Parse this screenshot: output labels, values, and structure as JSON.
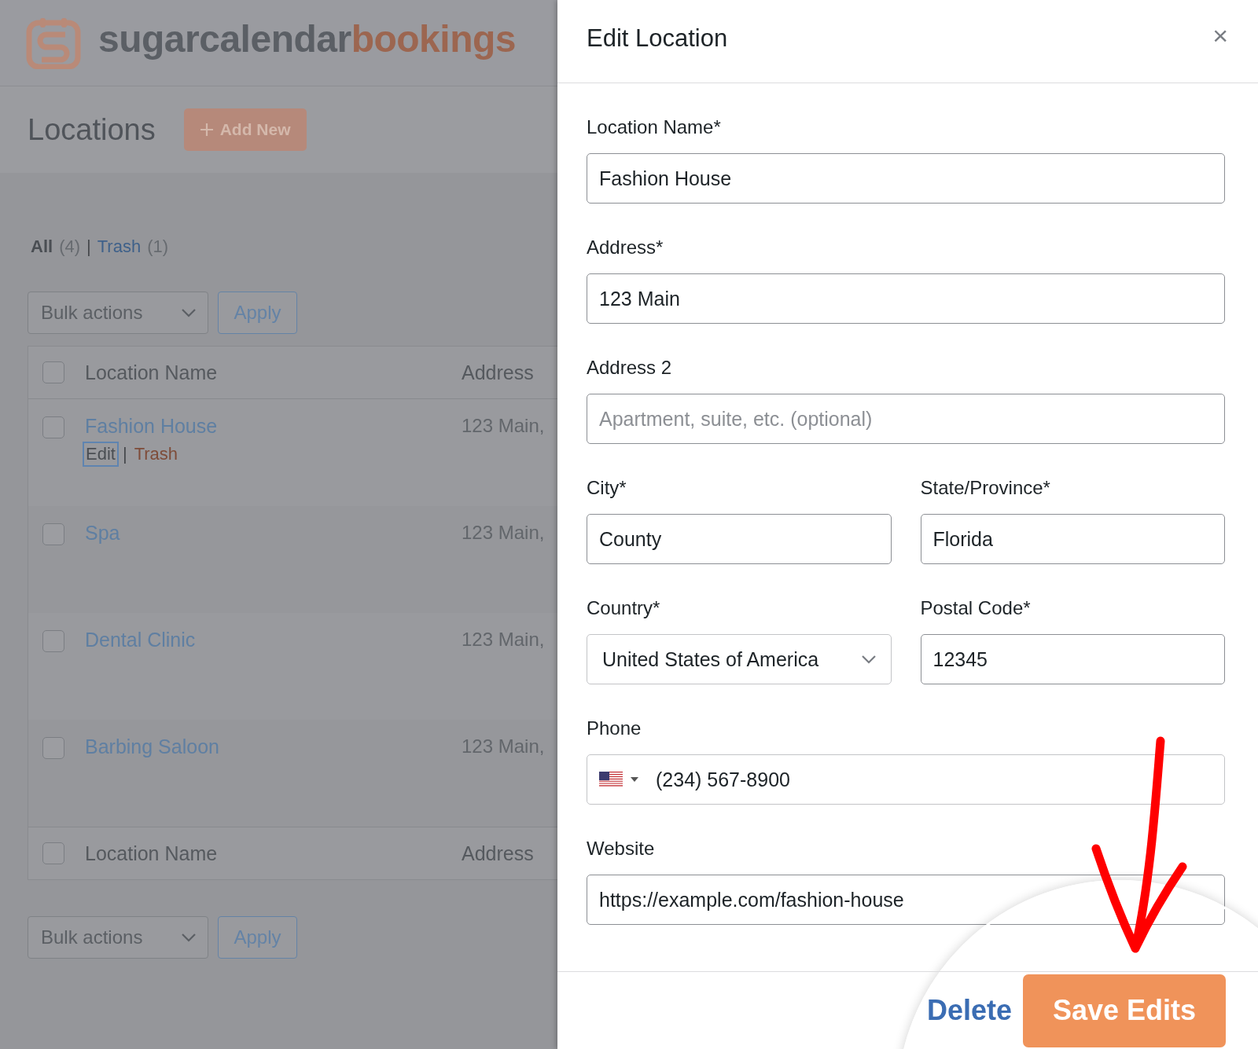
{
  "logo": {
    "text_1": "sugarcalendar",
    "text_2": "bookings"
  },
  "page": {
    "title": "Locations",
    "add_button": "Add New"
  },
  "filters": {
    "separator": "|",
    "items": [
      {
        "label": "All",
        "count": "(4)",
        "selected": true
      },
      {
        "label": "Trash",
        "count": "(1)",
        "selected": false
      }
    ]
  },
  "bulk_top": {
    "select": "Bulk actions",
    "apply": "Apply"
  },
  "table": {
    "columns": [
      "Location Name",
      "Address"
    ],
    "footer_columns": [
      "Location Name",
      "Address"
    ],
    "header_checked": false,
    "footer_checked": false,
    "rows": [
      {
        "name": "Fashion House",
        "address": "123 Main,",
        "checked": false,
        "separator": "|",
        "actions": [
          {
            "label": "Edit",
            "focused": true,
            "kind": "edit"
          },
          {
            "label": "Trash",
            "focused": false,
            "kind": "trash"
          }
        ]
      },
      {
        "name": "Spa",
        "address": "123 Main,",
        "checked": false
      },
      {
        "name": "Dental Clinic",
        "address": "123 Main,",
        "checked": false
      },
      {
        "name": "Barbing Saloon",
        "address": "123 Main,",
        "checked": false
      }
    ]
  },
  "bulk_bottom": {
    "select": "Bulk actions",
    "apply": "Apply"
  },
  "panel": {
    "title": "Edit Location",
    "close": "×",
    "rows": [
      [
        {
          "kind": "text",
          "label": "Location Name*",
          "value": "Fashion House"
        }
      ],
      [
        {
          "kind": "text",
          "label": "Address*",
          "value": "123 Main"
        }
      ],
      [
        {
          "kind": "text",
          "label": "Address 2",
          "placeholder": "Apartment, suite, etc. (optional)"
        }
      ],
      [
        {
          "kind": "text",
          "label": "City*",
          "value": "County"
        },
        {
          "kind": "text",
          "label": "State/Province*",
          "value": "Florida"
        }
      ],
      [
        {
          "kind": "select",
          "label": "Country*",
          "value": "United States of America"
        },
        {
          "kind": "text",
          "label": "Postal Code*",
          "value": "12345"
        }
      ],
      [
        {
          "kind": "phone",
          "label": "Phone",
          "value": "(234) 567-8900"
        }
      ],
      [
        {
          "kind": "text",
          "label": "Website",
          "value": "https://example.com/fashion-house"
        }
      ]
    ],
    "delete": "Delete",
    "save": "Save Edits"
  }
}
